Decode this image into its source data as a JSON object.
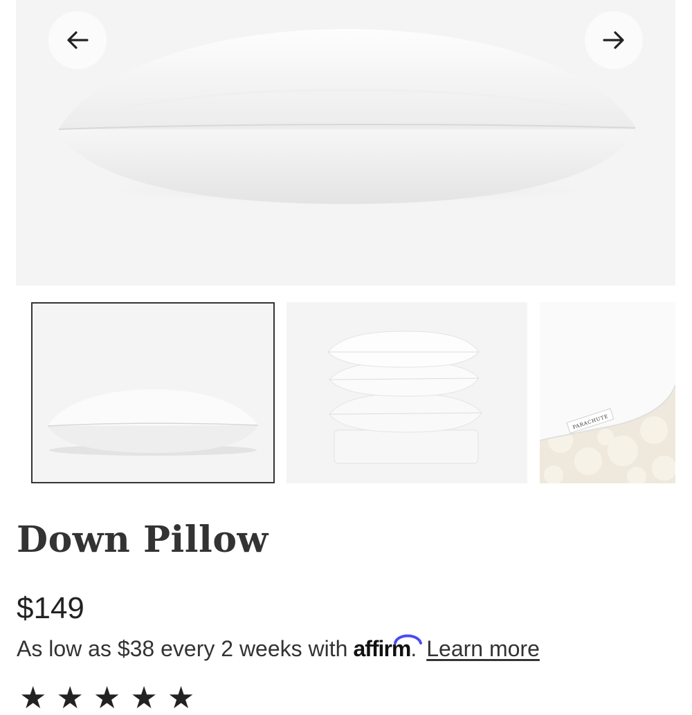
{
  "gallery": {
    "hero_alt": "Down Pillow",
    "prev_icon": "arrow-left-icon",
    "next_icon": "arrow-right-icon",
    "thumbnails": [
      {
        "alt": "Down Pillow front view",
        "selected": true
      },
      {
        "alt": "Stack of down pillows",
        "selected": false
      },
      {
        "alt": "Pillow corner with PARACHUTE label",
        "selected": false
      }
    ],
    "label_text": "PARACHUTE"
  },
  "product": {
    "title": "Down Pillow",
    "price": "$149"
  },
  "financing": {
    "text": "As low as $38 every 2 weeks with",
    "brand": "affirm",
    "period": ".",
    "link_label": "Learn more"
  },
  "rating": {
    "stars": [
      "★",
      "★",
      "★",
      "★",
      "★"
    ]
  }
}
